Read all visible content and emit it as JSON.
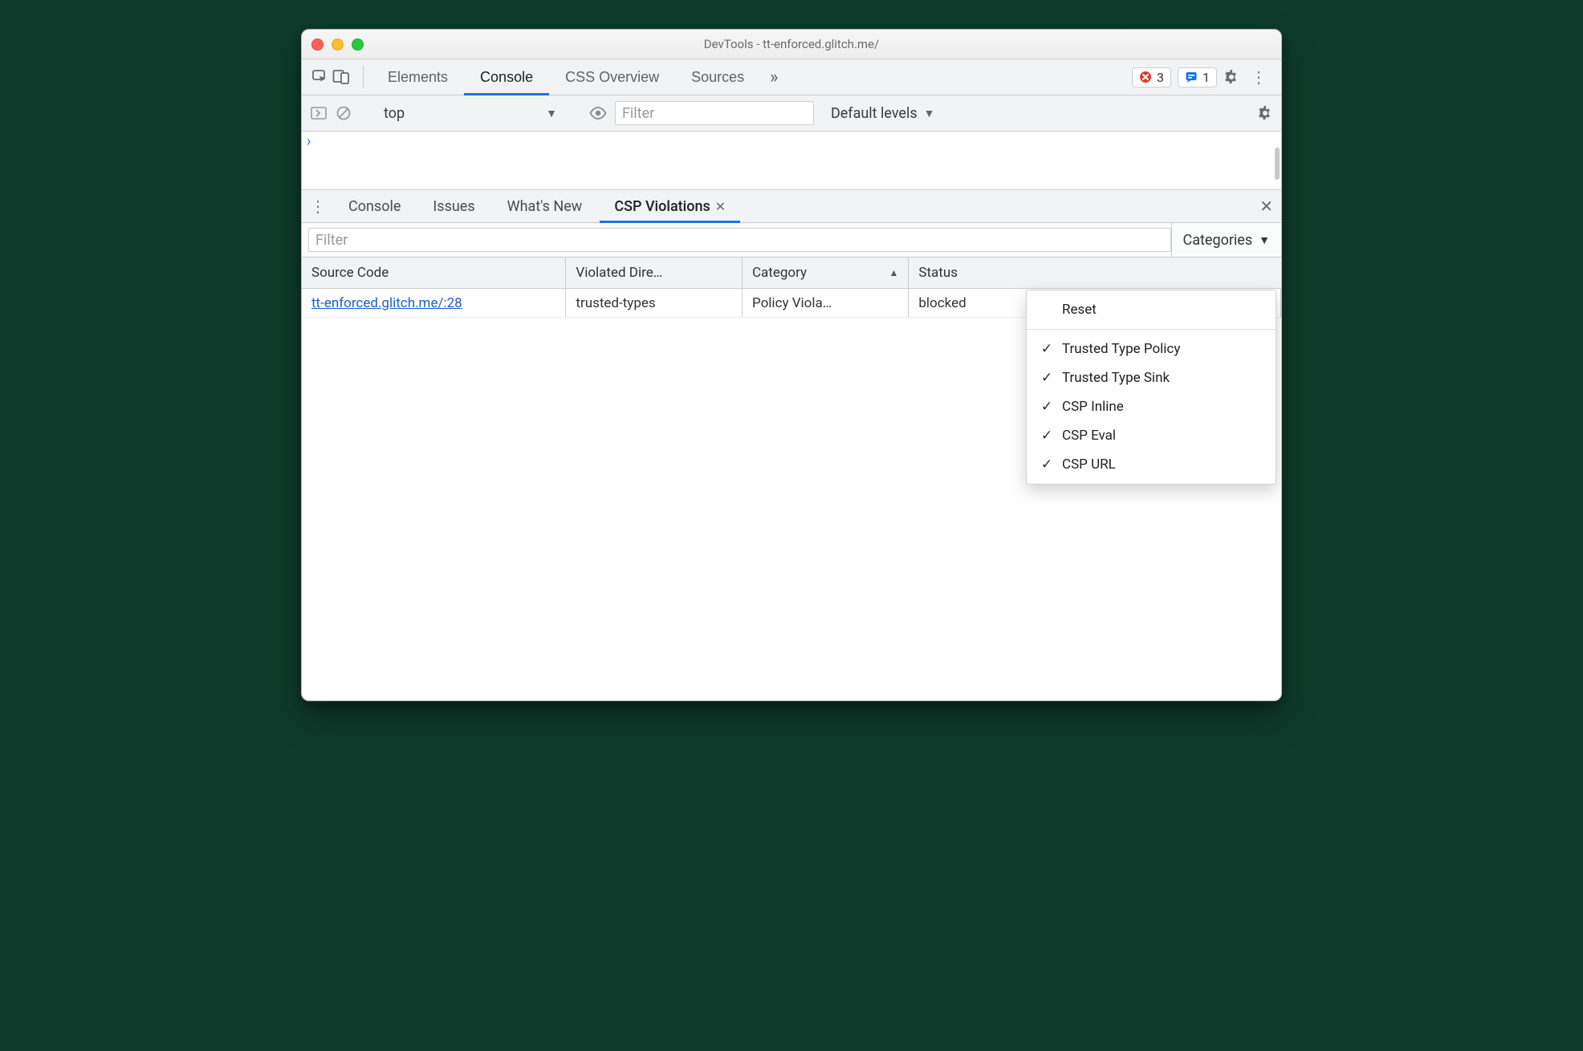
{
  "window": {
    "title": "DevTools - tt-enforced.glitch.me/"
  },
  "top_tabs": {
    "items": [
      "Elements",
      "Console",
      "CSS Overview",
      "Sources"
    ],
    "active_index": 1,
    "more_glyph": "»"
  },
  "badges": {
    "errors": "3",
    "issues": "1"
  },
  "console_bar": {
    "context": "top",
    "filter_placeholder": "Filter",
    "levels": "Default levels"
  },
  "drawer_tabs": {
    "items": [
      "Console",
      "Issues",
      "What's New",
      "CSP Violations"
    ],
    "active_index": 3
  },
  "csp": {
    "filter_placeholder": "Filter",
    "categories_label": "Categories",
    "columns": {
      "source": "Source Code",
      "directive": "Violated Dire…",
      "category": "Category",
      "status": "Status"
    },
    "row": {
      "source": "tt-enforced.glitch.me/:28",
      "directive": "trusted-types",
      "category": "Policy Viola…",
      "status": "blocked"
    },
    "menu": {
      "reset": "Reset",
      "options": [
        "Trusted Type Policy",
        "Trusted Type Sink",
        "CSP Inline",
        "CSP Eval",
        "CSP URL"
      ]
    }
  }
}
